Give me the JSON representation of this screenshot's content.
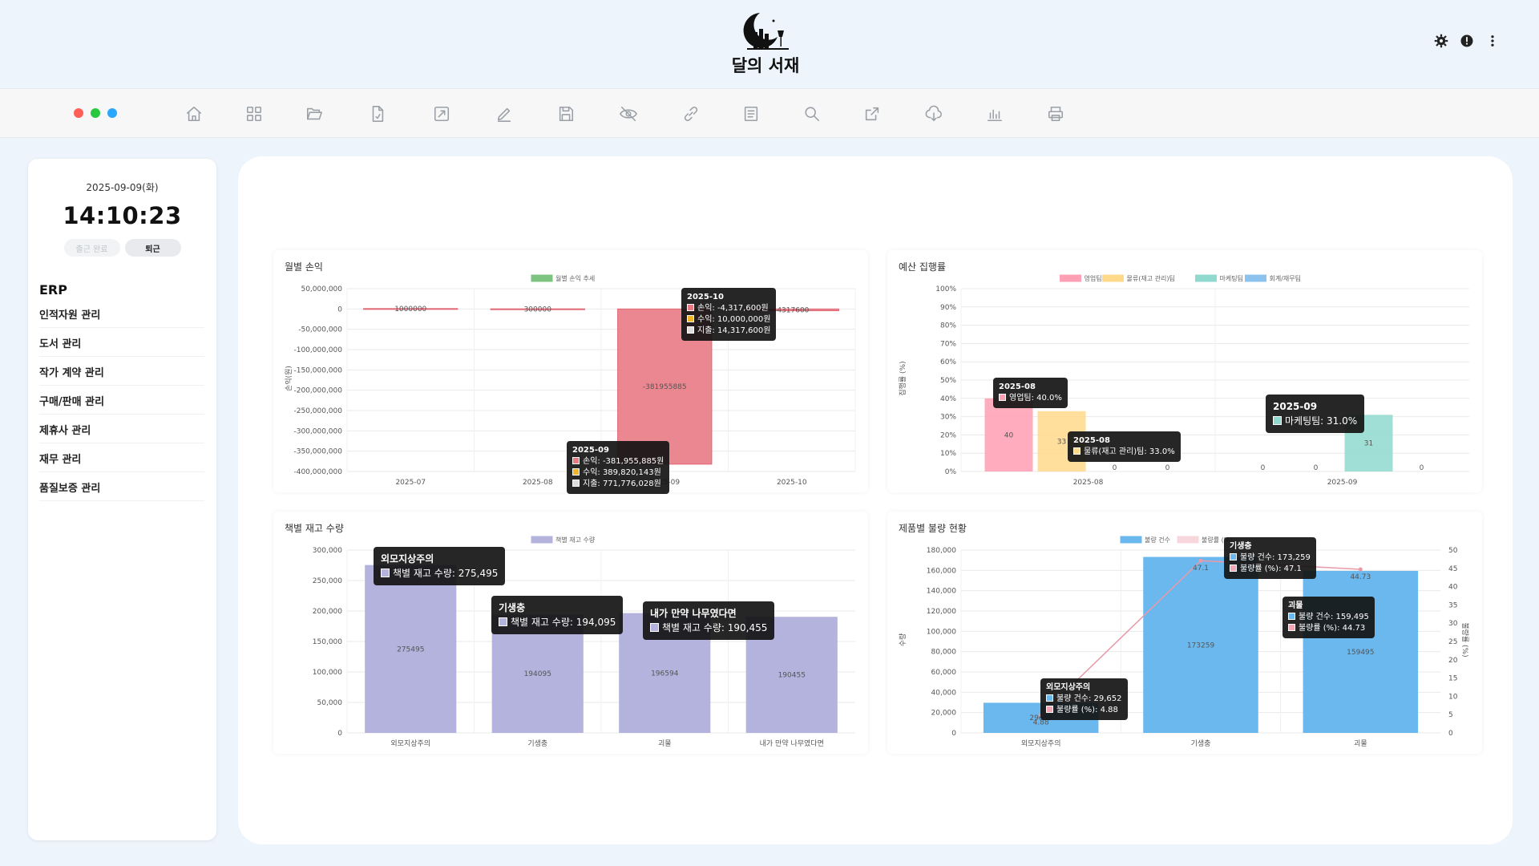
{
  "app": {
    "title": "달의 서재"
  },
  "header_icons": [
    "gear-icon",
    "alert-icon",
    "more-vertical-icon"
  ],
  "window_dots": [
    "#ff5f57",
    "#28c840",
    "#2aa6ff"
  ],
  "toolbar_icons": [
    "home-icon",
    "grid-icon",
    "folder-open-icon",
    "file-icon",
    "expand-icon",
    "edit-icon",
    "save-icon",
    "eye-off-icon",
    "link-icon",
    "document-icon",
    "search-icon",
    "external-link-icon",
    "cloud-download-icon",
    "bar-chart-icon",
    "print-icon"
  ],
  "sidebar": {
    "date": "2025-09-09(화)",
    "time": "14:10:23",
    "clock_in": "출근 완료",
    "clock_out": "퇴근",
    "section": "ERP",
    "items": [
      "인적자원 관리",
      "도서 관리",
      "작가 계약 관리",
      "구매/판매 관리",
      "제휴사 관리",
      "재무 관리",
      "품질보증 관리"
    ]
  },
  "chart_data": [
    {
      "title": "월별 손익",
      "type": "bar",
      "legend": [
        "월별 손익 추세"
      ],
      "categories": [
        "2025-07",
        "2025-08",
        "2025-09",
        "2025-10"
      ],
      "values": [
        1000000,
        300000,
        -381955885,
        -4317600
      ],
      "data_labels": [
        "1000000",
        "300000",
        "-381955885",
        "-4317600"
      ],
      "ylabel": "손익(원)",
      "ylim": [
        -400000000,
        50000000
      ],
      "yticks": [
        "50,000,000",
        "0",
        "-50,000,000",
        "-100,000,000",
        "-150,000,000",
        "-200,000,000",
        "-250,000,000",
        "-300,000,000",
        "-350,000,000",
        "-400,000,000"
      ],
      "color": "#e87a84",
      "tooltips": [
        {
          "title": "2025-10",
          "lines": [
            "손익: -4,317,600원",
            "수익: 10,000,000원",
            "지출: 14,317,600원"
          ]
        },
        {
          "title": "2025-09",
          "lines": [
            "손익: -381,955,885원",
            "수익: 389,820,143원",
            "지출: 771,776,028원"
          ]
        }
      ]
    },
    {
      "title": "예산 집행률",
      "type": "bar",
      "legend": [
        "영업팀",
        "물류(재고 관리)팀",
        "마케팅팀",
        "회계/재무팀"
      ],
      "legend_colors": [
        "#ff9fb3",
        "#ffd98a",
        "#8fd9cf",
        "#8cc2ee"
      ],
      "categories": [
        "2025-08",
        "2025-09"
      ],
      "series": [
        {
          "name": "영업팀",
          "values": [
            40,
            0
          ]
        },
        {
          "name": "물류(재고 관리)팀",
          "values": [
            33,
            0
          ]
        },
        {
          "name": "마케팅팀",
          "values": [
            0,
            31
          ]
        },
        {
          "name": "회계/재무팀",
          "values": [
            0,
            0
          ]
        }
      ],
      "ylabel": "집행률 (%)",
      "ylim": [
        0,
        100
      ],
      "yticks": [
        "100%",
        "90%",
        "80%",
        "70%",
        "60%",
        "50%",
        "40%",
        "30%",
        "20%",
        "10%",
        "0%"
      ],
      "zero_labels": [
        "0",
        "0",
        "0",
        "0",
        "0"
      ],
      "bar_labels": [
        "40",
        "33",
        "31"
      ],
      "tooltips": [
        {
          "title": "2025-08",
          "lines": [
            "영업팀: 40.0%"
          ]
        },
        {
          "title": "2025-08",
          "lines": [
            "물류(재고 관리)팀: 33.0%"
          ]
        },
        {
          "title": "2025-09",
          "lines": [
            "마케팅팀: 31.0%"
          ]
        }
      ]
    },
    {
      "title": "책별 재고 수량",
      "type": "bar",
      "legend": [
        "책별 재고 수량"
      ],
      "categories": [
        "외모지상주의",
        "기생충",
        "괴물",
        "내가 만약 나무였다면"
      ],
      "values": [
        275495,
        194095,
        196594,
        190455
      ],
      "data_labels": [
        "275495",
        "194095",
        "196594",
        "190455"
      ],
      "ylim": [
        0,
        300000
      ],
      "yticks": [
        "300,000",
        "250,000",
        "200,000",
        "150,000",
        "100,000",
        "50,000",
        "0"
      ],
      "color": "#b3b3de",
      "tooltips": [
        {
          "title": "외모지상주의",
          "lines": [
            "책별 재고 수량: 275,495"
          ]
        },
        {
          "title": "기생충",
          "lines": [
            "책별 재고 수량: 194,095"
          ]
        },
        {
          "title": "내가 만약 나무였다면",
          "lines": [
            "책별 재고 수량: 190,455"
          ]
        }
      ]
    },
    {
      "title": "제품별 불량 현황",
      "type": "bar",
      "legend": [
        "불량 건수",
        "불량률 (%)"
      ],
      "categories": [
        "외모지상주의",
        "기생충",
        "괴물"
      ],
      "series": [
        {
          "name": "불량 건수",
          "values": [
            29652,
            173259,
            159495
          ]
        },
        {
          "name": "불량률 (%)",
          "values": [
            4.88,
            47.1,
            44.73
          ]
        }
      ],
      "data_labels": [
        "29652",
        "173259",
        "159495"
      ],
      "rate_labels": [
        "4.88",
        "47.1",
        "44.73"
      ],
      "ylabel": "수량",
      "y2label": "불량률 (%)",
      "ylim": [
        0,
        180000
      ],
      "y2lim": [
        0,
        50
      ],
      "yticks": [
        "180,000",
        "160,000",
        "140,000",
        "120,000",
        "100,000",
        "80,000",
        "60,000",
        "40,000",
        "20,000",
        "0"
      ],
      "y2ticks": [
        "50",
        "45",
        "40",
        "35",
        "30",
        "25",
        "20",
        "15",
        "10",
        "5",
        "0"
      ],
      "tooltips": [
        {
          "title": "기생충",
          "lines": [
            "불량 건수: 173,259",
            "불량률 (%): 47.1"
          ]
        },
        {
          "title": "괴물",
          "lines": [
            "불량 건수: 159,495",
            "불량률 (%): 44.73"
          ]
        },
        {
          "title": "외모지상주의",
          "lines": [
            "불량 건수: 29,652",
            "불량률 (%): 4.88"
          ]
        }
      ]
    }
  ]
}
